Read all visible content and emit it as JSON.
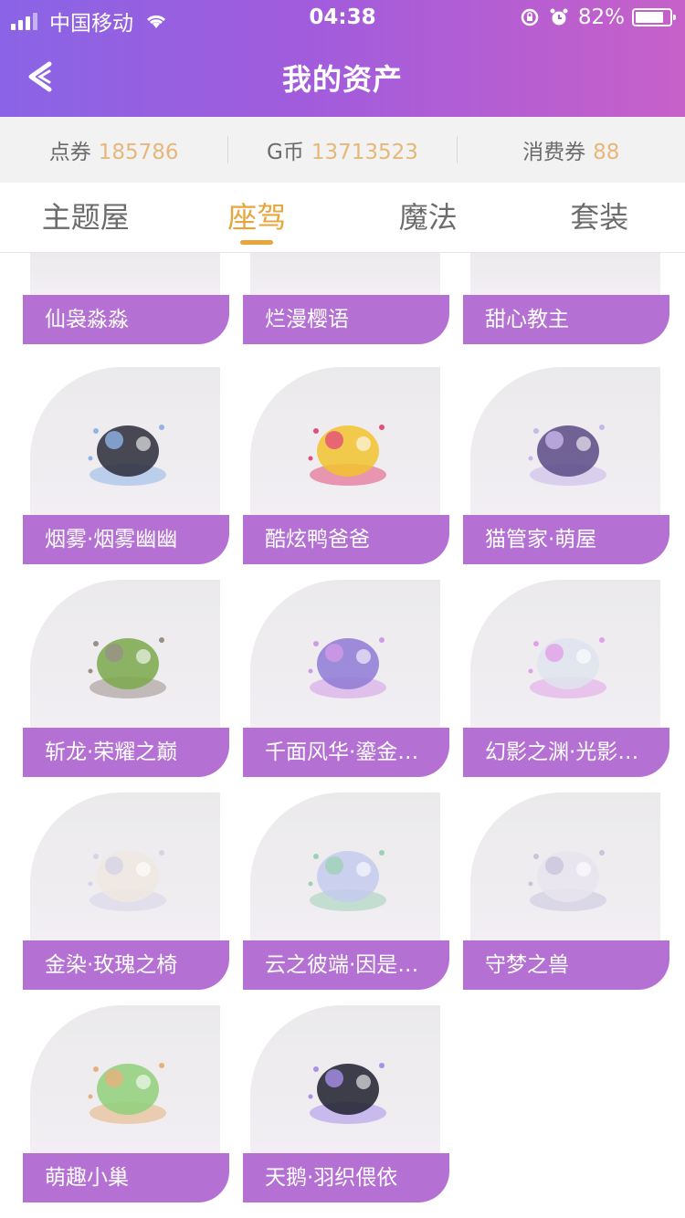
{
  "status_bar": {
    "carrier": "中国移动",
    "time": "04:38",
    "battery": "82%",
    "battery_level": 0.82
  },
  "header": {
    "title": "我的资产"
  },
  "balances": [
    {
      "label": "点券",
      "value": "185786"
    },
    {
      "label": "G币",
      "value": "13713523"
    },
    {
      "label": "消费券",
      "value": "88"
    }
  ],
  "tabs": [
    {
      "label": "主题屋"
    },
    {
      "label": "座驾",
      "active": true
    },
    {
      "label": "魔法"
    },
    {
      "label": "套装"
    }
  ],
  "items": [
    {
      "name": "仙袅淼淼"
    },
    {
      "name": "烂漫樱语"
    },
    {
      "name": "甜心教主"
    },
    {
      "name": "烟雾·烟雾幽幽"
    },
    {
      "name": "酷炫鸭爸爸"
    },
    {
      "name": "猫管家·萌屋"
    },
    {
      "name": "斩龙·荣耀之巅"
    },
    {
      "name": "千面风华·鎏金…"
    },
    {
      "name": "幻影之渊·光影…"
    },
    {
      "name": "金染·玫瑰之椅"
    },
    {
      "name": "云之彼端·因是…"
    },
    {
      "name": "守梦之兽"
    },
    {
      "name": "萌趣小巢"
    },
    {
      "name": "天鹅·羽织偎依"
    }
  ]
}
